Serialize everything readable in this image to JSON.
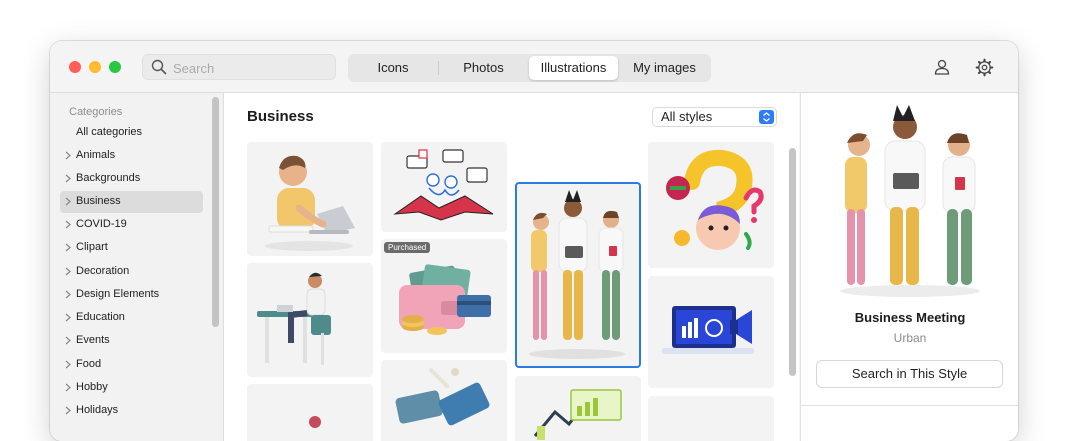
{
  "toolbar": {
    "search_placeholder": "Search",
    "tabs": [
      {
        "label": "Icons",
        "active": false
      },
      {
        "label": "Photos",
        "active": false
      },
      {
        "label": "Illustrations",
        "active": true
      },
      {
        "label": "My images",
        "active": false
      }
    ],
    "icons": {
      "search": "search-icon",
      "account": "person-icon",
      "settings": "gear-icon"
    }
  },
  "sidebar": {
    "heading": "Categories",
    "all_label": "All categories",
    "items": [
      {
        "label": "Animals"
      },
      {
        "label": "Backgrounds"
      },
      {
        "label": "Business",
        "active": true
      },
      {
        "label": "COVID-19"
      },
      {
        "label": "Clipart"
      },
      {
        "label": "Decoration"
      },
      {
        "label": "Design Elements"
      },
      {
        "label": "Education"
      },
      {
        "label": "Events"
      },
      {
        "label": "Food"
      },
      {
        "label": "Hobby"
      },
      {
        "label": "Holidays"
      }
    ]
  },
  "main": {
    "title": "Business",
    "style_filter": "All styles",
    "purchased_badge": "Purchased",
    "tiles": [
      "man-with-laptop-illustration",
      "people-chatting-illustration",
      "business-meeting-illustration",
      "question-mark-illustration",
      "man-at-desk-illustration",
      "wallet-with-coins-illustration",
      "computer-with-megaphone-illustration",
      "partial-illustration",
      "credit-card-illustration",
      "analytics-charts-illustration",
      "partial-illustration"
    ]
  },
  "detail": {
    "title": "Business Meeting",
    "style": "Urban",
    "button_label": "Search in This Style"
  },
  "colors": {
    "accent": "#2a7be4",
    "close": "#fe5f57",
    "minimize": "#febc2e",
    "zoom": "#28c840"
  }
}
